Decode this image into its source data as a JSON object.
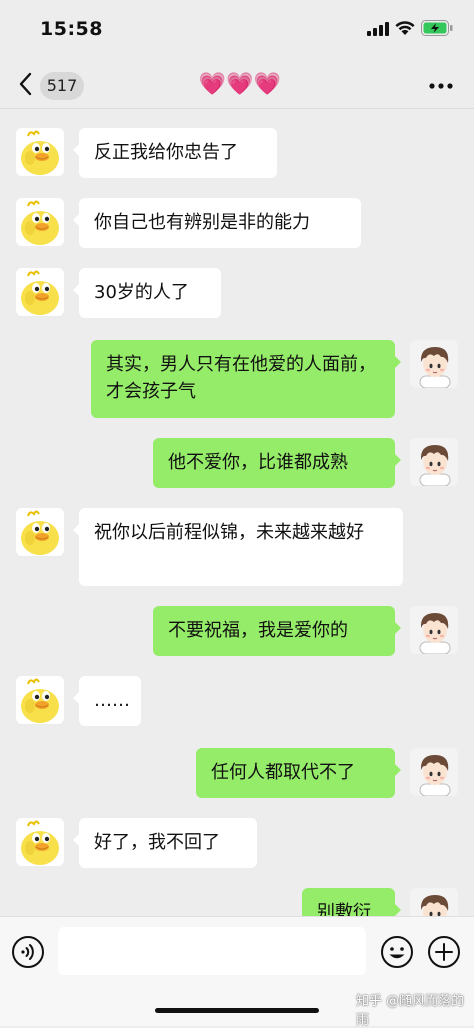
{
  "status_bar": {
    "time": "15:58"
  },
  "nav": {
    "unread_count": "517",
    "title": "💗💗💗"
  },
  "messages": [
    {
      "side": "left",
      "text": "反正我给你忠告了"
    },
    {
      "side": "left",
      "text": "你自己也有辨别是非的能力"
    },
    {
      "side": "left",
      "text": "30岁的人了"
    },
    {
      "side": "right",
      "text": "其实，男人只有在他爱的人面前，才会孩子气"
    },
    {
      "side": "right",
      "text": "他不爱你，比谁都成熟"
    },
    {
      "side": "left",
      "text": "祝你以后前程似锦，未来越来越好"
    },
    {
      "side": "right",
      "text": "不要祝福，我是爱你的"
    },
    {
      "side": "left",
      "text": "……"
    },
    {
      "side": "right",
      "text": "任何人都取代不了"
    },
    {
      "side": "left",
      "text": "好了，我不回了"
    },
    {
      "side": "right",
      "text": "别敷衍"
    }
  ],
  "icons": {
    "back": "chevron-left-icon",
    "more": "more-dots-icon",
    "voice": "voice-icon",
    "emoji": "emoji-icon",
    "plus": "plus-icon"
  },
  "colors": {
    "background": "#ededed",
    "sent_bubble": "#95ec69",
    "received_bubble": "#ffffff"
  },
  "watermark": "知乎 @随风而落的雨"
}
